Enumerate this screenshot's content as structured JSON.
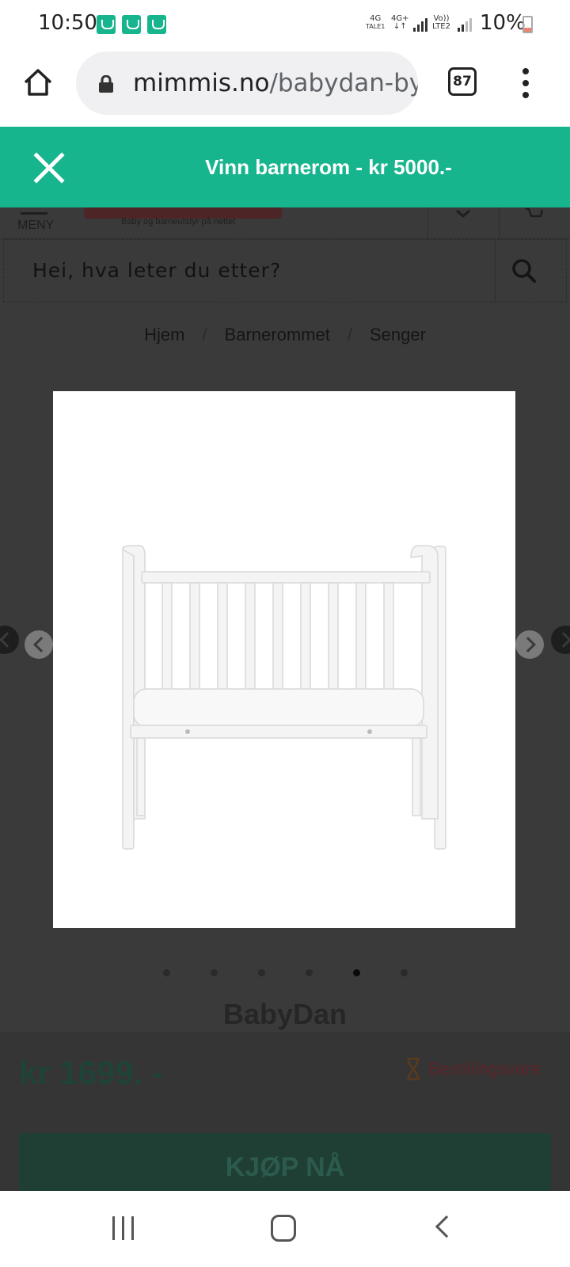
{
  "status_bar": {
    "time": "10:50",
    "network1_top": "4G",
    "network1_bottom": "TALE1",
    "network2_top": "4G+",
    "network2_bottom": "↓↑",
    "network3_top": "Vo))",
    "network3_bottom": "LTE2",
    "battery": "10%",
    "notification_icons": [
      "app-notification-icon",
      "app-notification-icon",
      "app-notification-icon"
    ]
  },
  "browser": {
    "url_domain": "mimmis.no",
    "url_path": "/babydan-by-",
    "tab_count": "87"
  },
  "promo": {
    "text": "Vinn barnerom - kr 5000.-"
  },
  "header": {
    "menu_label": "MENY",
    "tagline": "Baby og barneutstyr på nettet"
  },
  "search": {
    "placeholder": "Hei, hva leter du etter?"
  },
  "breadcrumb": {
    "items": [
      "Hjem",
      "Barnerommet",
      "Senger"
    ],
    "separator": "/"
  },
  "product": {
    "image_count": 6,
    "active_image": 5,
    "brand": "BabyDan",
    "price": "kr 1699. -",
    "stock_status": "Bestillingsvare",
    "buy_label": "KJØP NÅ"
  },
  "colors": {
    "accent": "#17b58e",
    "overlay": "#3a3a3a"
  }
}
